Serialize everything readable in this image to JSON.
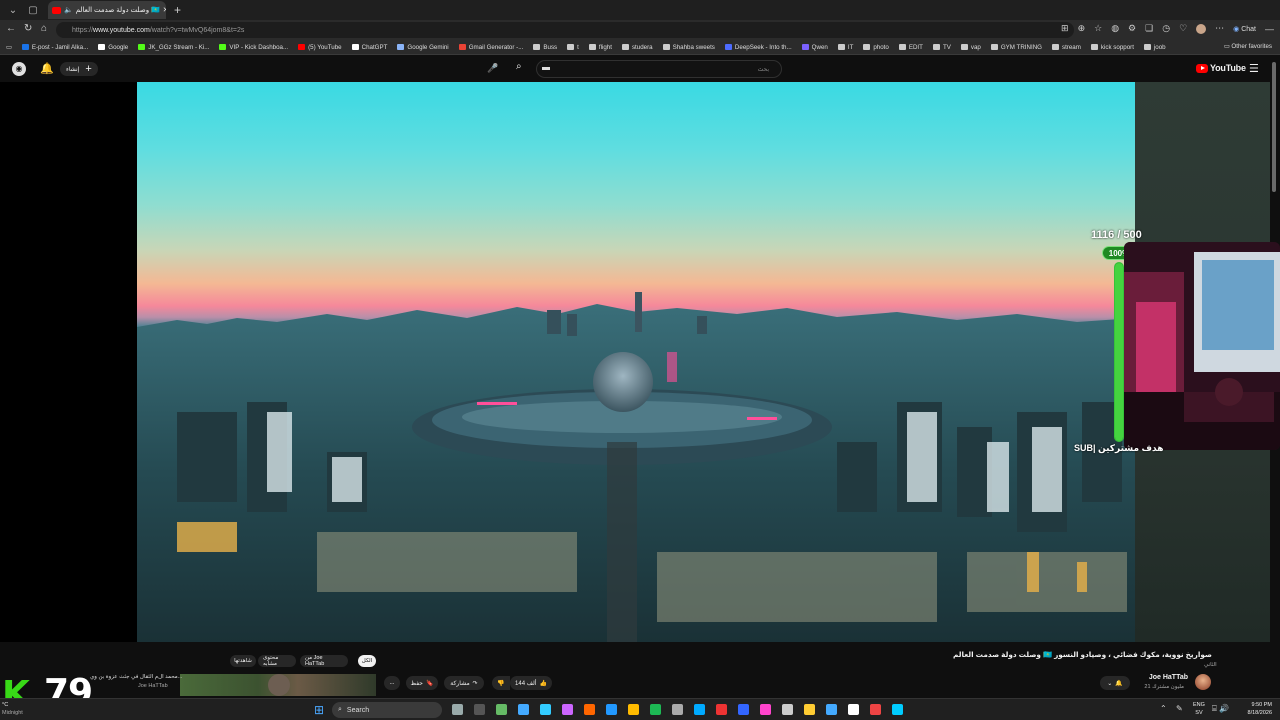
{
  "browser": {
    "tab_title": "وصلت دولة صدمت العالم 🇰🇿",
    "url_prefix": "https://",
    "url_domain": "www.youtube.com",
    "url_path": "/watch?v=twMvQ64jom8&t=2s",
    "chat_label": "Chat",
    "bookmarks": [
      {
        "label": "E-post - Jamil Alka...",
        "color": "#1a73e8"
      },
      {
        "label": "Google",
        "color": "#ffffff"
      },
      {
        "label": "JK_GGz Stream - Ki...",
        "color": "#53fc18"
      },
      {
        "label": "VIP - Kick Dashboa...",
        "color": "#53fc18"
      },
      {
        "label": "(5) YouTube",
        "color": "#ff0000"
      },
      {
        "label": "ChatGPT",
        "color": "#ffffff"
      },
      {
        "label": "Google Gemini",
        "color": "#8ab4f8"
      },
      {
        "label": "Gmail Generator -...",
        "color": "#ea4335"
      },
      {
        "label": "Buss",
        "color": "#cccccc"
      },
      {
        "label": "t",
        "color": "#cccccc"
      },
      {
        "label": "flight",
        "color": "#cccccc"
      },
      {
        "label": "studera",
        "color": "#cccccc"
      },
      {
        "label": "Shahba sweets",
        "color": "#cccccc"
      },
      {
        "label": "DeepSeek - Into th...",
        "color": "#4d6bfe"
      },
      {
        "label": "Qwen",
        "color": "#7b61ff"
      },
      {
        "label": "IT",
        "color": "#cccccc"
      },
      {
        "label": "photo",
        "color": "#cccccc"
      },
      {
        "label": "EDIT",
        "color": "#cccccc"
      },
      {
        "label": "TV",
        "color": "#cccccc"
      },
      {
        "label": "vap",
        "color": "#cccccc"
      },
      {
        "label": "GYM TRINING",
        "color": "#cccccc"
      },
      {
        "label": "stream",
        "color": "#cccccc"
      },
      {
        "label": "kick sopport",
        "color": "#cccccc"
      },
      {
        "label": "joob",
        "color": "#cccccc"
      }
    ],
    "other_favorites": "Other favorites"
  },
  "youtube": {
    "create_label": "إنشاء",
    "search_placeholder": "بحث",
    "logo_text": "YouTube",
    "video_title": "وصلت دولة صدمت العالم 🇰🇿 صواريخ نووية، مكوك فضائي ، وصيادو النسور",
    "channel_name": "Joe HaTTab",
    "channel_subs": "21 مليون مشترك",
    "channel_flag": "الثاني",
    "like_count": "144 ألف",
    "share_label": "مشاركة",
    "save_label": "حفظ",
    "more_label": "...",
    "chips": [
      "الكل",
      "من Joe HaTTab",
      "محتوى مشابه",
      "شاهدتها"
    ],
    "related_title": "محمد ال‌م الثقال في جثث عزو‌ة بن وي...",
    "related_channel": "Joe HaTTab"
  },
  "stream_overlay": {
    "goal_text": "1116 / 500",
    "goal_percent_label": "100%",
    "goal_fraction": 1.0,
    "sub_label": "SUB| هدف مشتركين",
    "kick_letter": "K",
    "viewer_count": "79"
  },
  "taskbar": {
    "search_label": "Search",
    "lang_top": "ENG",
    "lang_bottom": "SV",
    "time": "9:50 PM",
    "date": "8/18/2026",
    "weather": "°C",
    "weather_sub": "Midnight"
  }
}
